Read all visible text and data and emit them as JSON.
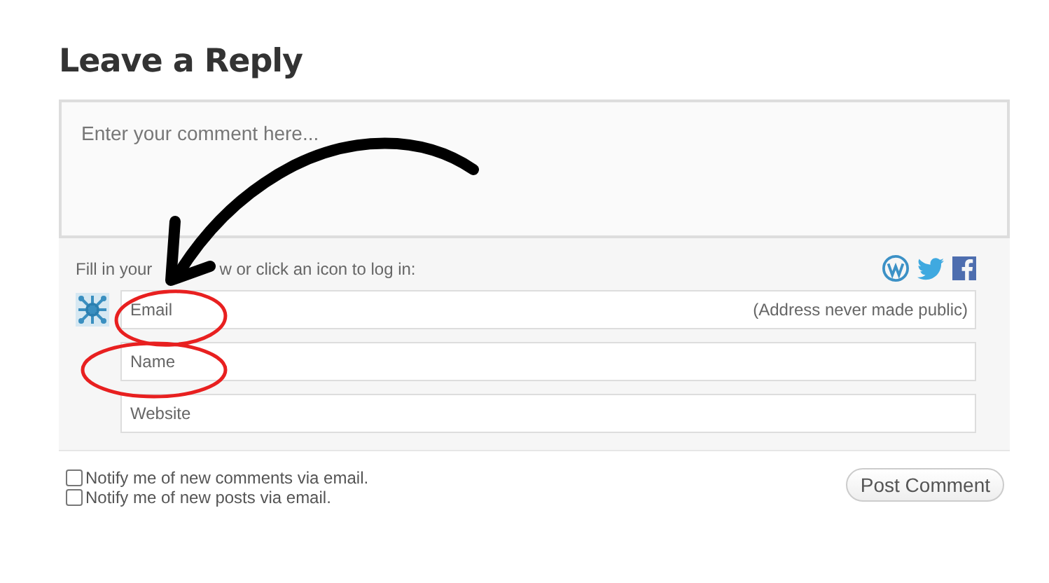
{
  "heading": "Leave a Reply",
  "comment": {
    "placeholder": "Enter your comment here..."
  },
  "instruction_parts": [
    "Fill in your",
    "w or click an icon to log in:"
  ],
  "fields": [
    {
      "placeholder": "Email",
      "hint": "(Address never made public)"
    },
    {
      "placeholder": "Name"
    },
    {
      "placeholder": "Website"
    }
  ],
  "notifications": [
    {
      "label": "Notify me of new comments via email.",
      "checked": false
    },
    {
      "label": "Notify me of new posts via email.",
      "checked": false
    }
  ],
  "submit": {
    "label": "Post Comment"
  }
}
